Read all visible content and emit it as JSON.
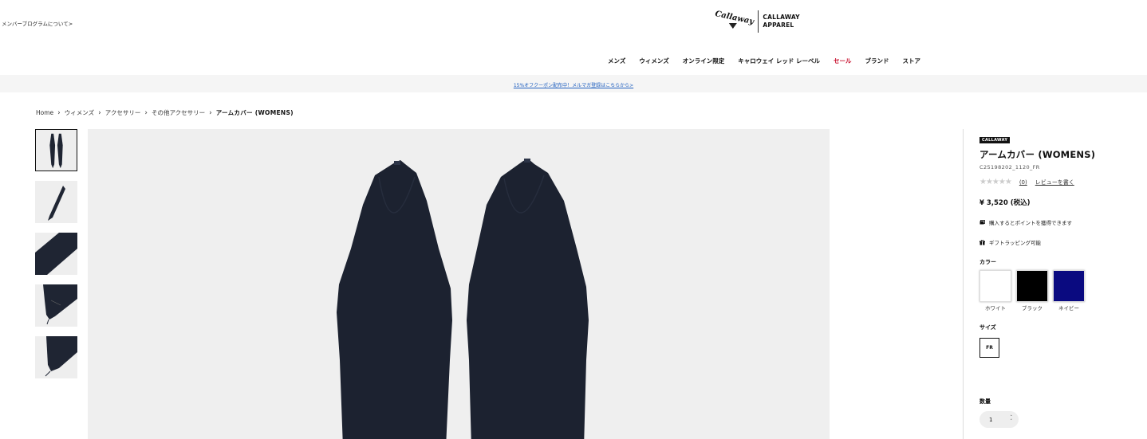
{
  "header": {
    "member_link": "メンバープログラムについて>",
    "logo_script": "Callaway",
    "logo_line1": "CALLAWAY",
    "logo_line2": "APPAREL"
  },
  "nav": {
    "items": [
      "メンズ",
      "ウィメンズ",
      "オンライン限定",
      "キャロウェイ レッド レーベル",
      "セール",
      "ブランド",
      "ストア"
    ],
    "sale_color": "#c8102e"
  },
  "promo": {
    "text": "15%オフクーポン配布中！メルマガ登録はこちらから>"
  },
  "breadcrumb": {
    "items": [
      "Home",
      "ウィメンズ",
      "アクセサリー",
      "その他アクセサリー"
    ],
    "current": "アームカバー (WOMENS)"
  },
  "gallery": {
    "thumb_count": 5,
    "selected_index": 0
  },
  "product": {
    "brand_badge": "CALLAWAY",
    "title": "アームカバー (WOMENS)",
    "sku": "C25198202_1120_FR",
    "stars": "★★★★★",
    "review_count": "(0)",
    "review_write": "レビューを書く",
    "price": "¥ 3,520 (税込)",
    "points_text": "購入するとポイントを獲得できます",
    "gift_text": "ギフトラッピング可能",
    "color_label": "カラー",
    "colors": [
      {
        "name": "ホワイト",
        "hex": "#ffffff"
      },
      {
        "name": "ブラック",
        "hex": "#000000"
      },
      {
        "name": "ネイビー",
        "hex": "#0a0a80"
      }
    ],
    "size_label": "サイズ",
    "size": "FR",
    "qty_label": "数量",
    "qty_value": "1"
  }
}
